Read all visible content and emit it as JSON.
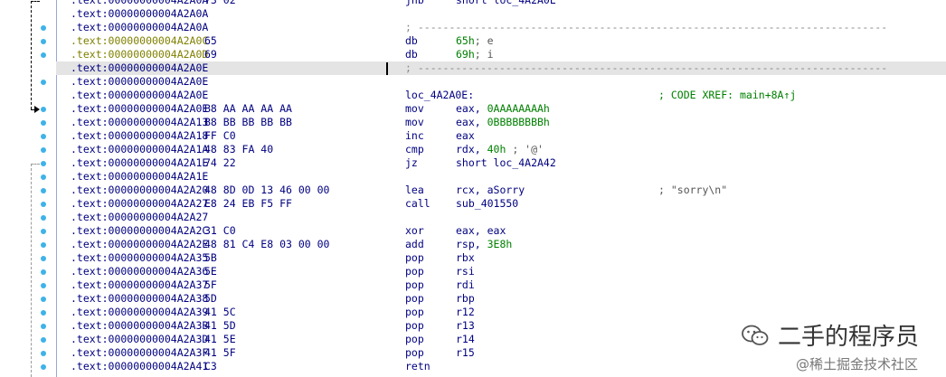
{
  "lines": [
    {
      "addr": ".text:00000000004A2A0A",
      "bytes": "73 02",
      "mnem": "jnb",
      "ops": "short loc_4A2A0E"
    },
    {
      "addr": ".text:00000000004A2A0A"
    },
    {
      "addr": ".text:00000000004A2A0A",
      "sep": "; ---------------------------------------------------------------------------"
    },
    {
      "addr": ".text:00000000004A2A0C",
      "type": "data",
      "bytes": "65",
      "mnem": "db",
      "ops_num": "65h",
      "ops_cmt": "; e"
    },
    {
      "addr": ".text:00000000004A2A0D",
      "type": "data",
      "bytes": "69",
      "mnem": "db",
      "ops_num": "69h",
      "ops_cmt": "; i"
    },
    {
      "addr": ".text:00000000004A2A0E",
      "hl": true,
      "sep": "; ---------------------------------------------------------------------------"
    },
    {
      "addr": ".text:00000000004A2A0E"
    },
    {
      "addr": ".text:00000000004A2A0E",
      "label": "loc_4A2A0E:",
      "xref": "; CODE XREF: main+8A↑j"
    },
    {
      "addr": ".text:00000000004A2A0E",
      "bytes": "B8 AA AA AA AA",
      "mnem": "mov",
      "ops": "eax, ",
      "ops_num": "0AAAAAAAAh"
    },
    {
      "addr": ".text:00000000004A2A13",
      "bytes": "B8 BB BB BB BB",
      "mnem": "mov",
      "ops": "eax, ",
      "ops_num": "0BBBBBBBBh"
    },
    {
      "addr": ".text:00000000004A2A18",
      "bytes": "FF C0",
      "mnem": "inc",
      "ops": "eax"
    },
    {
      "addr": ".text:00000000004A2A1A",
      "bytes": "48 83 FA 40",
      "mnem": "cmp",
      "ops": "rdx, ",
      "ops_num": "40h",
      "ops_cmt": " ; '@'"
    },
    {
      "addr": ".text:00000000004A2A1E",
      "bytes": "74 22",
      "mnem": "jz",
      "ops": "short loc_4A2A42"
    },
    {
      "addr": ".text:00000000004A2A1E"
    },
    {
      "addr": ".text:00000000004A2A20",
      "bytes": "48 8D 0D 13 46 00 00",
      "mnem": "lea",
      "ops": "rcx, aSorry",
      "cmt": "; \"sorry\\n\""
    },
    {
      "addr": ".text:00000000004A2A27",
      "bytes": "E8 24 EB F5 FF",
      "mnem": "call",
      "ops": "sub_401550"
    },
    {
      "addr": ".text:00000000004A2A27"
    },
    {
      "addr": ".text:00000000004A2A2C",
      "bytes": "31 C0",
      "mnem": "xor",
      "ops": "eax, eax"
    },
    {
      "addr": ".text:00000000004A2A2E",
      "bytes": "48 81 C4 E8 03 00 00",
      "mnem": "add",
      "ops": "rsp, ",
      "ops_num": "3E8h"
    },
    {
      "addr": ".text:00000000004A2A35",
      "bytes": "5B",
      "mnem": "pop",
      "ops": "rbx"
    },
    {
      "addr": ".text:00000000004A2A36",
      "bytes": "5E",
      "mnem": "pop",
      "ops": "rsi"
    },
    {
      "addr": ".text:00000000004A2A37",
      "bytes": "5F",
      "mnem": "pop",
      "ops": "rdi"
    },
    {
      "addr": ".text:00000000004A2A38",
      "bytes": "5D",
      "mnem": "pop",
      "ops": "rbp"
    },
    {
      "addr": ".text:00000000004A2A39",
      "bytes": "41 5C",
      "mnem": "pop",
      "ops": "r12"
    },
    {
      "addr": ".text:00000000004A2A3B",
      "bytes": "41 5D",
      "mnem": "pop",
      "ops": "r13"
    },
    {
      "addr": ".text:00000000004A2A3D",
      "bytes": "41 5E",
      "mnem": "pop",
      "ops": "r14"
    },
    {
      "addr": ".text:00000000004A2A3F",
      "bytes": "41 5F",
      "mnem": "pop",
      "ops": "r15"
    },
    {
      "addr": ".text:00000000004A2A41",
      "bytes": "C3",
      "mnem": "retn"
    }
  ],
  "watermark": {
    "title": "二手的程序员",
    "sub": "@稀土掘金技术社区",
    "icon": "wechat-icon"
  },
  "colors": {
    "address": "#000080",
    "data_address": "#808000",
    "number": "#008000",
    "breakpoint_dot": "#3fb2e8"
  }
}
